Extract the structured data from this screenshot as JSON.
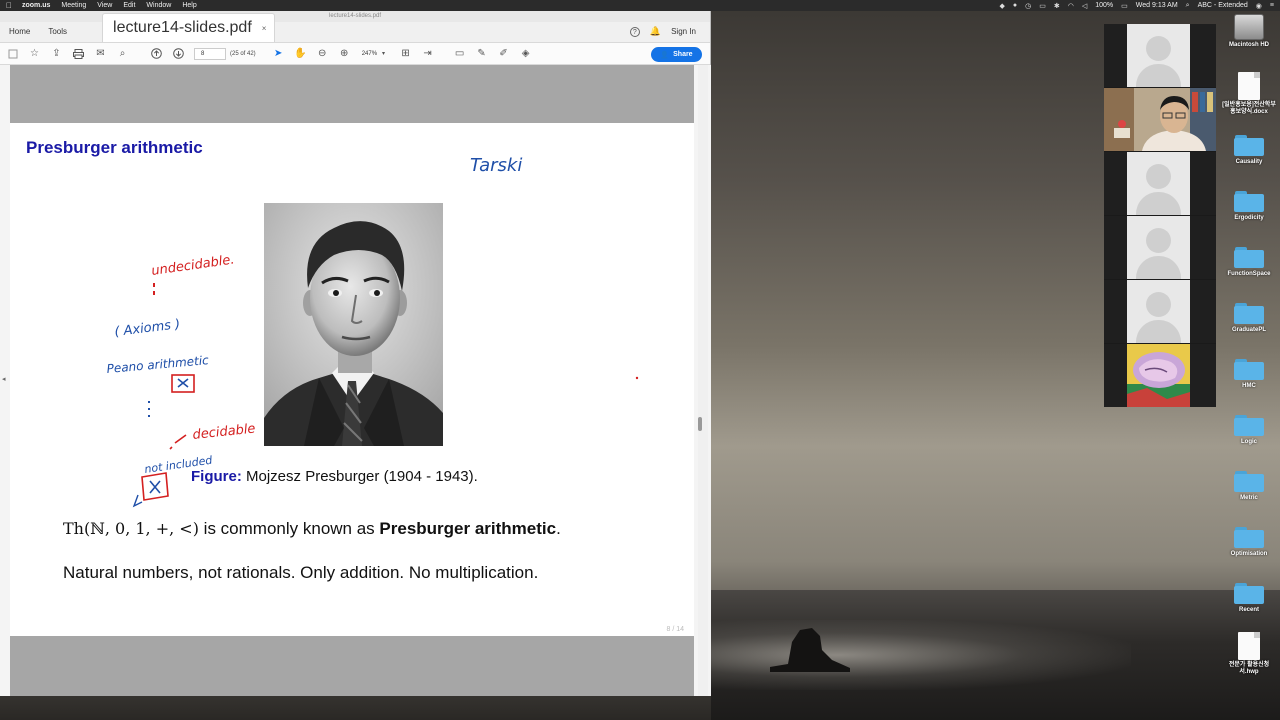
{
  "menubar": {
    "app": "zoom.us",
    "items": [
      "Meeting",
      "View",
      "Edit",
      "Window",
      "Help"
    ],
    "battery": "100%",
    "input_source": "ABC - Extended",
    "clock": "Wed 9:13 AM"
  },
  "acrobat": {
    "window_title": "lecture14-slides.pdf",
    "tabs": {
      "home": "Home",
      "tools": "Tools",
      "doc": "lecture14-slides.pdf",
      "sign_in": "Sign In"
    },
    "toolbar": {
      "page_input": "8",
      "page_count": "(25 of 42)",
      "zoom": "247%",
      "share": "Share"
    }
  },
  "slide": {
    "title": "Presburger arithmetic",
    "caption_label": "Figure:",
    "caption_text": "Mojzesz Presburger (1904 - 1943).",
    "formula_math": "Th(ℕ, 0, 1, +, <)",
    "formula_mid": " is commonly known as ",
    "formula_bold": "Presburger arithmetic",
    "formula_end": ".",
    "line2": "Natural numbers, not rationals. Only addition. No multiplication.",
    "page_number": "8 / 14",
    "annotations": {
      "tarski": "Tarski",
      "undecidable": "undecidable.",
      "axioms": "( Axioms )",
      "peano": "Peano arithmetic",
      "decidable": "decidable",
      "included": "not included"
    }
  },
  "zoom": {
    "participant_count": 6
  },
  "desktop": {
    "items": [
      {
        "label": "Macintosh HD",
        "type": "drive"
      },
      {
        "label": "[일반홍보용]전산학부 홍보양식.docx",
        "type": "doc"
      },
      {
        "label": "Causality",
        "type": "folder"
      },
      {
        "label": "Ergodicity",
        "type": "folder"
      },
      {
        "label": "FunctionSpace",
        "type": "folder"
      },
      {
        "label": "GraduatePL",
        "type": "folder"
      },
      {
        "label": "HMC",
        "type": "folder"
      },
      {
        "label": "Logic",
        "type": "folder"
      },
      {
        "label": "Metric",
        "type": "folder"
      },
      {
        "label": "Optimisation",
        "type": "folder"
      },
      {
        "label": "Recent",
        "type": "folder"
      },
      {
        "label": "전문가 활용신청서.hwp",
        "type": "doc"
      }
    ]
  },
  "colors": {
    "slide_title": "#1a1aa6",
    "ink_blue": "#1f4fa8",
    "ink_red": "#d42020",
    "share_button": "#1473e6"
  }
}
